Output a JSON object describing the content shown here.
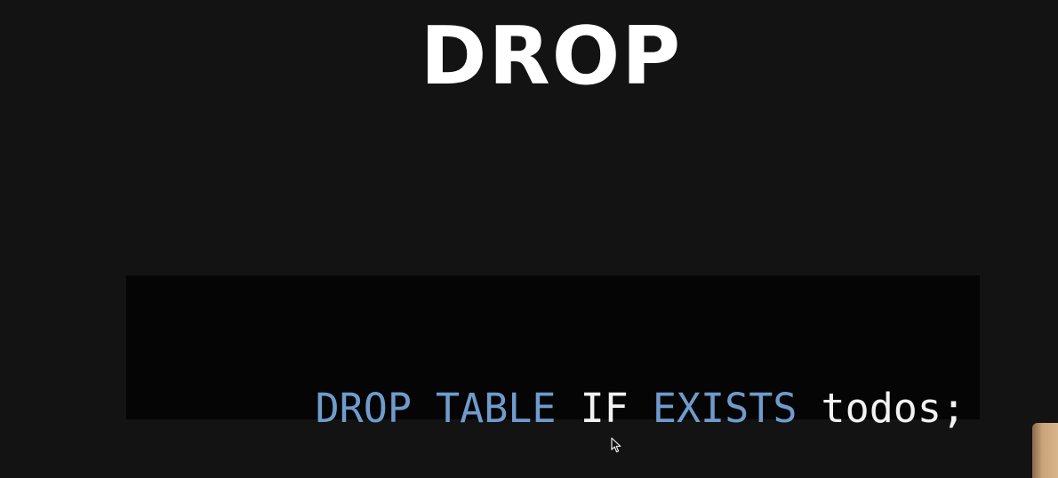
{
  "slide": {
    "title": "DROP",
    "code": {
      "tokens": [
        {
          "text": "DROP",
          "kind": "keyword"
        },
        {
          "text": " ",
          "kind": "space"
        },
        {
          "text": "TABLE",
          "kind": "keyword"
        },
        {
          "text": " ",
          "kind": "space"
        },
        {
          "text": "IF",
          "kind": "plain"
        },
        {
          "text": " ",
          "kind": "space"
        },
        {
          "text": "EXISTS",
          "kind": "keyword"
        },
        {
          "text": " ",
          "kind": "space"
        },
        {
          "text": "todos;",
          "kind": "plain"
        }
      ]
    }
  },
  "colors": {
    "background": "#131313",
    "code_background": "#050505",
    "keyword": "#6f9bcd",
    "plain": "#f2f2f2",
    "title": "#ffffff"
  },
  "icons": {
    "cursor": "mouse-pointer-icon"
  }
}
